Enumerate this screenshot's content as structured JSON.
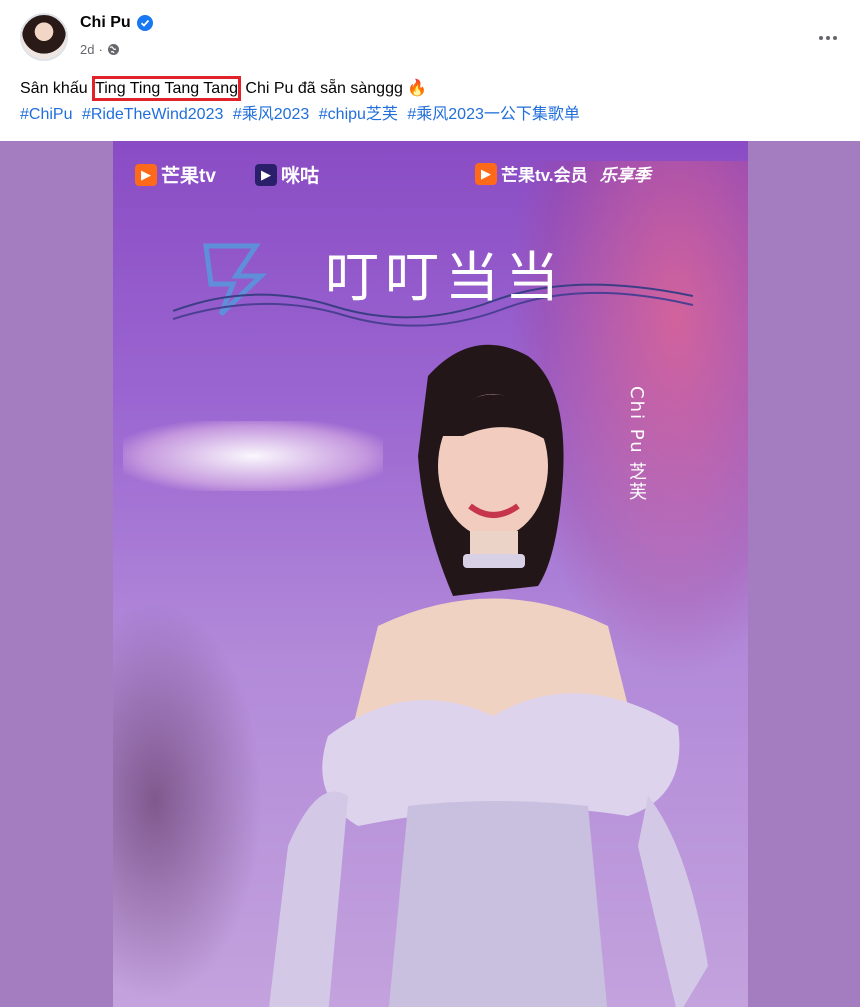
{
  "post": {
    "author": "Chi Pu",
    "time": "2d",
    "privacy_icon": "globe-icon",
    "verified_icon": "verified-badge-icon",
    "more_icon": "more-options-icon"
  },
  "caption": {
    "before": "Sân khấu ",
    "highlighted": "Ting Ting Tang Tang",
    "after": " Chi Pu đã sẵn sànggg ",
    "emoji": "🔥"
  },
  "hashtags": [
    "#ChiPu",
    "#RideTheWind2023",
    "#乘风2023",
    "#chipu芝芙",
    "#乘风2023一公下集歌单"
  ],
  "poster": {
    "logo_left": "芒果tv",
    "logo_mid": "咪咕",
    "logo_right": "芒果tv.会员",
    "logo_right_extra": "乐享季",
    "song_title": "叮叮当当",
    "singer_vertical": "Chi Pu 芝芙"
  },
  "colors": {
    "link": "#216fdb",
    "highlight_border": "#e0222b",
    "media_background": "#a47cc0",
    "verified": "#1877f2"
  }
}
